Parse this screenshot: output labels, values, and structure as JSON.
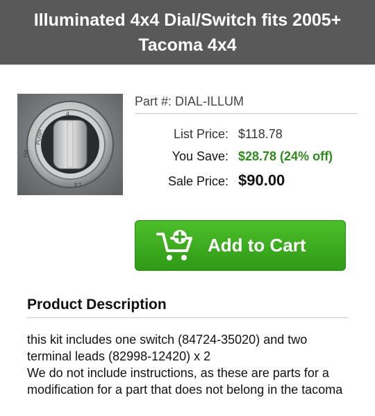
{
  "header": {
    "title": "Illuminated 4x4 Dial/Switch fits 2005+ Tacoma 4x4"
  },
  "product": {
    "part_label": "Part #: DIAL-ILLUM",
    "list_price_label": "List Price:",
    "list_price": "$118.78",
    "you_save_label": "You Save:",
    "you_save": "$28.78 (24% off)",
    "sale_price_label": "Sale Price:",
    "sale_price": "$90.00",
    "image_dial_text": {
      "top": "4",
      "push": "PUSH",
      "side": "H4",
      "bottom": "L4"
    }
  },
  "add_to_cart": {
    "label": "Add to Cart",
    "icon": "cart-add-icon"
  },
  "description": {
    "title": "Product Description",
    "line1": "this kit includes one switch (84724-35020) and two terminal leads (82998-12420) x 2",
    "line2": "We do not include instructions, as these are parts for a modification for a part that does not belong in the tacoma"
  },
  "colors": {
    "header_bg": "#595959",
    "button_green": "#3aa61c",
    "save_green": "#2f8a1e"
  }
}
